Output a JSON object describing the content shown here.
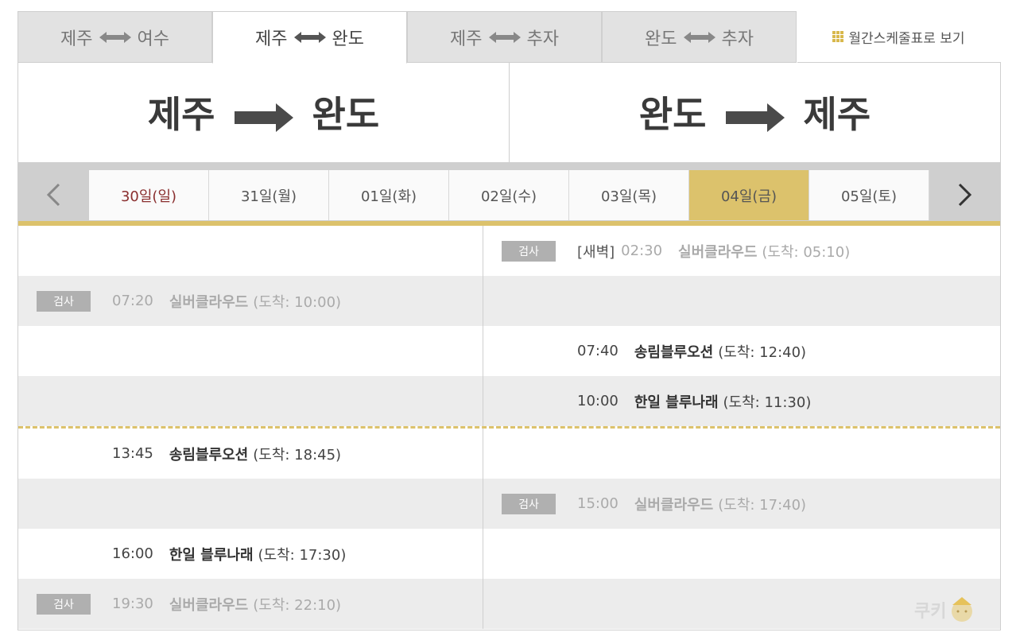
{
  "tabs": [
    {
      "from": "제주",
      "to": "여수",
      "active": false
    },
    {
      "from": "제주",
      "to": "완도",
      "active": true
    },
    {
      "from": "제주",
      "to": "추자",
      "active": false
    },
    {
      "from": "완도",
      "to": "추자",
      "active": false
    }
  ],
  "monthly_link": "월간스케줄표로 보기",
  "headers": {
    "left": {
      "from": "제주",
      "to": "완도"
    },
    "right": {
      "from": "완도",
      "to": "제주"
    }
  },
  "dates": [
    "30일(일)",
    "31일(월)",
    "01일(화)",
    "02일(수)",
    "03일(목)",
    "04일(금)",
    "05일(토)"
  ],
  "selected_date": "04일(금)",
  "badge_label": "검사",
  "rows": [
    {
      "left": null,
      "right": {
        "badge": true,
        "prefix": "[새벽]",
        "time": "02:30",
        "ship": "실버클라우드",
        "arrival": "(도착: 05:10)",
        "muted": true
      }
    },
    {
      "left": {
        "badge": true,
        "time": "07:20",
        "ship": "실버클라우드",
        "arrival": "(도착: 10:00)",
        "muted": true
      },
      "right": null
    },
    {
      "left": null,
      "right": {
        "badge": false,
        "time": "07:40",
        "ship": "송림블루오션",
        "arrival": "(도착: 12:40)",
        "muted": false
      }
    },
    {
      "left": null,
      "right": {
        "badge": false,
        "time": "10:00",
        "ship": "한일 블루나래",
        "arrival": "(도착: 11:30)",
        "muted": false
      }
    },
    {
      "left": {
        "badge": false,
        "time": "13:45",
        "ship": "송림블루오션",
        "arrival": "(도착: 18:45)",
        "muted": false
      },
      "right": null
    },
    {
      "left": null,
      "right": {
        "badge": true,
        "time": "15:00",
        "ship": "실버클라우드",
        "arrival": "(도착: 17:40)",
        "muted": true
      }
    },
    {
      "left": {
        "badge": false,
        "time": "16:00",
        "ship": "한일 블루나래",
        "arrival": "(도착: 17:30)",
        "muted": false
      },
      "right": null
    },
    {
      "left": {
        "badge": true,
        "time": "19:30",
        "ship": "실버클라우드",
        "arrival": "(도착: 22:10)",
        "muted": true
      },
      "right": null
    }
  ],
  "watermark": "쿠키"
}
